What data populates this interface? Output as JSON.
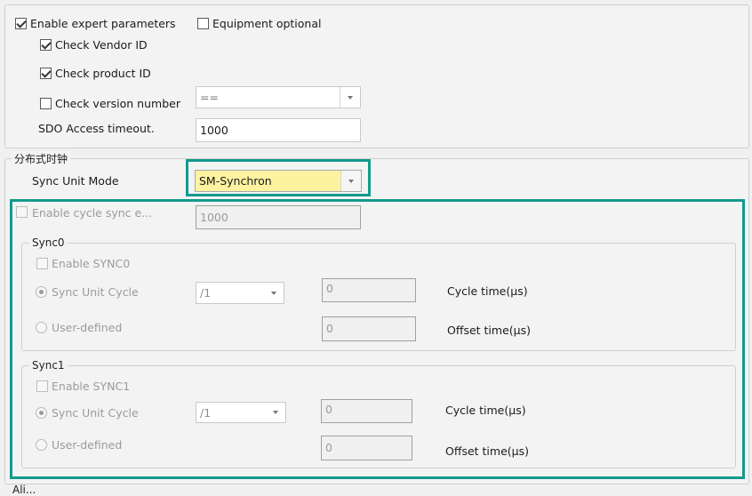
{
  "options": {
    "enable_expert_params": "Enable expert parameters",
    "equipment_optional": "Equipment optional",
    "check_vendor_id": "Check Vendor ID",
    "check_product_id": "Check product ID",
    "check_version_number": "Check version number",
    "version_compare_value": "==",
    "sdo_timeout_label": "SDO Access timeout.",
    "sdo_timeout_value": "1000"
  },
  "dc": {
    "group_title": "分布式时钟",
    "sync_unit_mode_label": "Sync Unit Mode",
    "sync_unit_mode_value": "SM-Synchron",
    "enable_cycle_sync_label": "Enable cycle sync e...",
    "cycle_sync_value": "1000",
    "sync0": {
      "title": "Sync0",
      "enable_label": "Enable SYNC0",
      "sync_unit_cycle_label": "Sync Unit Cycle",
      "divider_value": "/1",
      "user_defined_label": "User-defined",
      "cycle_time_value": "0",
      "offset_time_value": "0",
      "cycle_time_label": "Cycle time(µs)",
      "offset_time_label": "Offset time(µs)"
    },
    "sync1": {
      "title": "Sync1",
      "enable_label": "Enable SYNC1",
      "sync_unit_cycle_label": "Sync Unit Cycle",
      "divider_value": "/1",
      "user_defined_label": "User-defined",
      "cycle_time_value": "0",
      "offset_time_value": "0",
      "cycle_time_label": "Cycle time(µs)",
      "offset_time_label": "Offset time(µs)"
    }
  },
  "footer": {
    "next_group_title": "Ali..."
  },
  "colors": {
    "highlight": "#139a8e",
    "selected_field": "#fcf2a0"
  }
}
